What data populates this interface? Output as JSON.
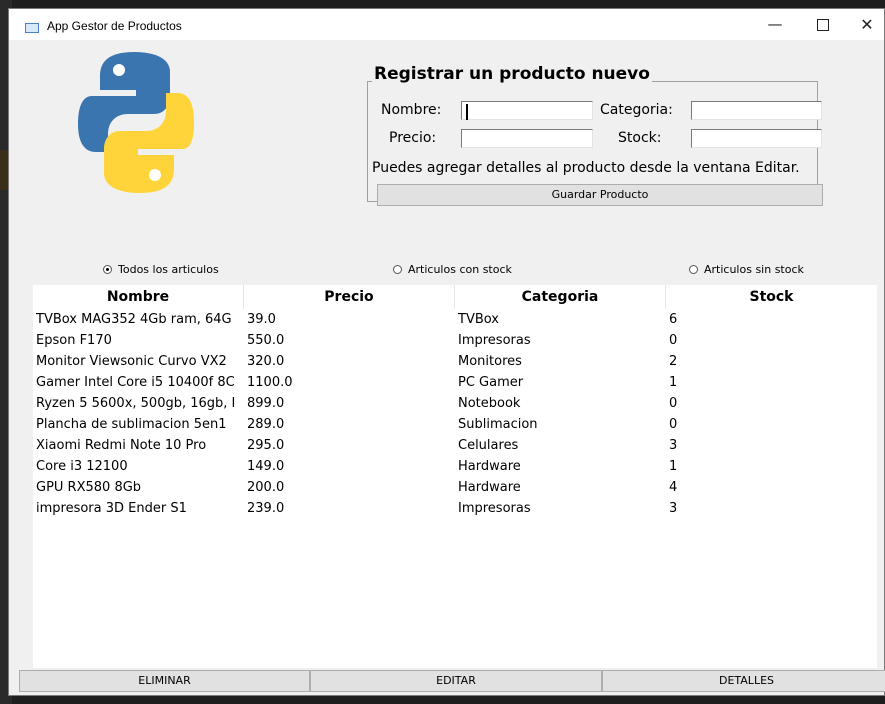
{
  "window": {
    "title": "App Gestor de Productos",
    "controls": {
      "minimize": "—",
      "close": "✕"
    }
  },
  "register": {
    "title": "Registrar un producto nuevo",
    "nombre_label": "Nombre:",
    "nombre_value": "",
    "categoria_label": "Categoria:",
    "categoria_value": "",
    "precio_label": "Precio:",
    "precio_value": "",
    "stock_label": "Stock:",
    "stock_value": "",
    "hint": "Puedes agregar detalles al producto desde la ventana Editar.",
    "save_button": "Guardar Producto"
  },
  "filters": [
    {
      "label": "Todos los articulos",
      "selected": true
    },
    {
      "label": "Articulos con stock",
      "selected": false
    },
    {
      "label": "Articulos sin stock",
      "selected": false
    }
  ],
  "table": {
    "columns": [
      "Nombre",
      "Precio",
      "Categoria",
      "Stock"
    ],
    "rows": [
      [
        "TVBox MAG352 4Gb ram, 64G",
        "39.0",
        "TVBox",
        "6"
      ],
      [
        "Epson F170",
        "550.0",
        "Impresoras",
        "0"
      ],
      [
        "Monitor Viewsonic Curvo VX2",
        "320.0",
        "Monitores",
        "2"
      ],
      [
        "Gamer Intel Core i5 10400f 8C",
        "1100.0",
        "PC Gamer",
        "1"
      ],
      [
        "Ryzen 5 5600x, 500gb, 16gb, I",
        "899.0",
        "Notebook",
        "0"
      ],
      [
        "Plancha de sublimacion 5en1",
        "289.0",
        "Sublimacion",
        "0"
      ],
      [
        "Xiaomi Redmi Note 10 Pro",
        "295.0",
        "Celulares",
        "3"
      ],
      [
        "Core i3 12100",
        "149.0",
        "Hardware",
        "1"
      ],
      [
        "GPU RX580 8Gb",
        "200.0",
        "Hardware",
        "4"
      ],
      [
        "impresora 3D Ender S1",
        "239.0",
        "Impresoras",
        "3"
      ]
    ]
  },
  "actions": {
    "delete": "ELIMINAR",
    "edit": "EDITAR",
    "details": "DETALLES"
  },
  "colors": {
    "python_blue": "#3a75b0",
    "python_yellow": "#ffd43b",
    "window_bg": "#f0f0f0"
  },
  "icons": {
    "app": "window-icon",
    "logo": "python-logo-icon"
  }
}
